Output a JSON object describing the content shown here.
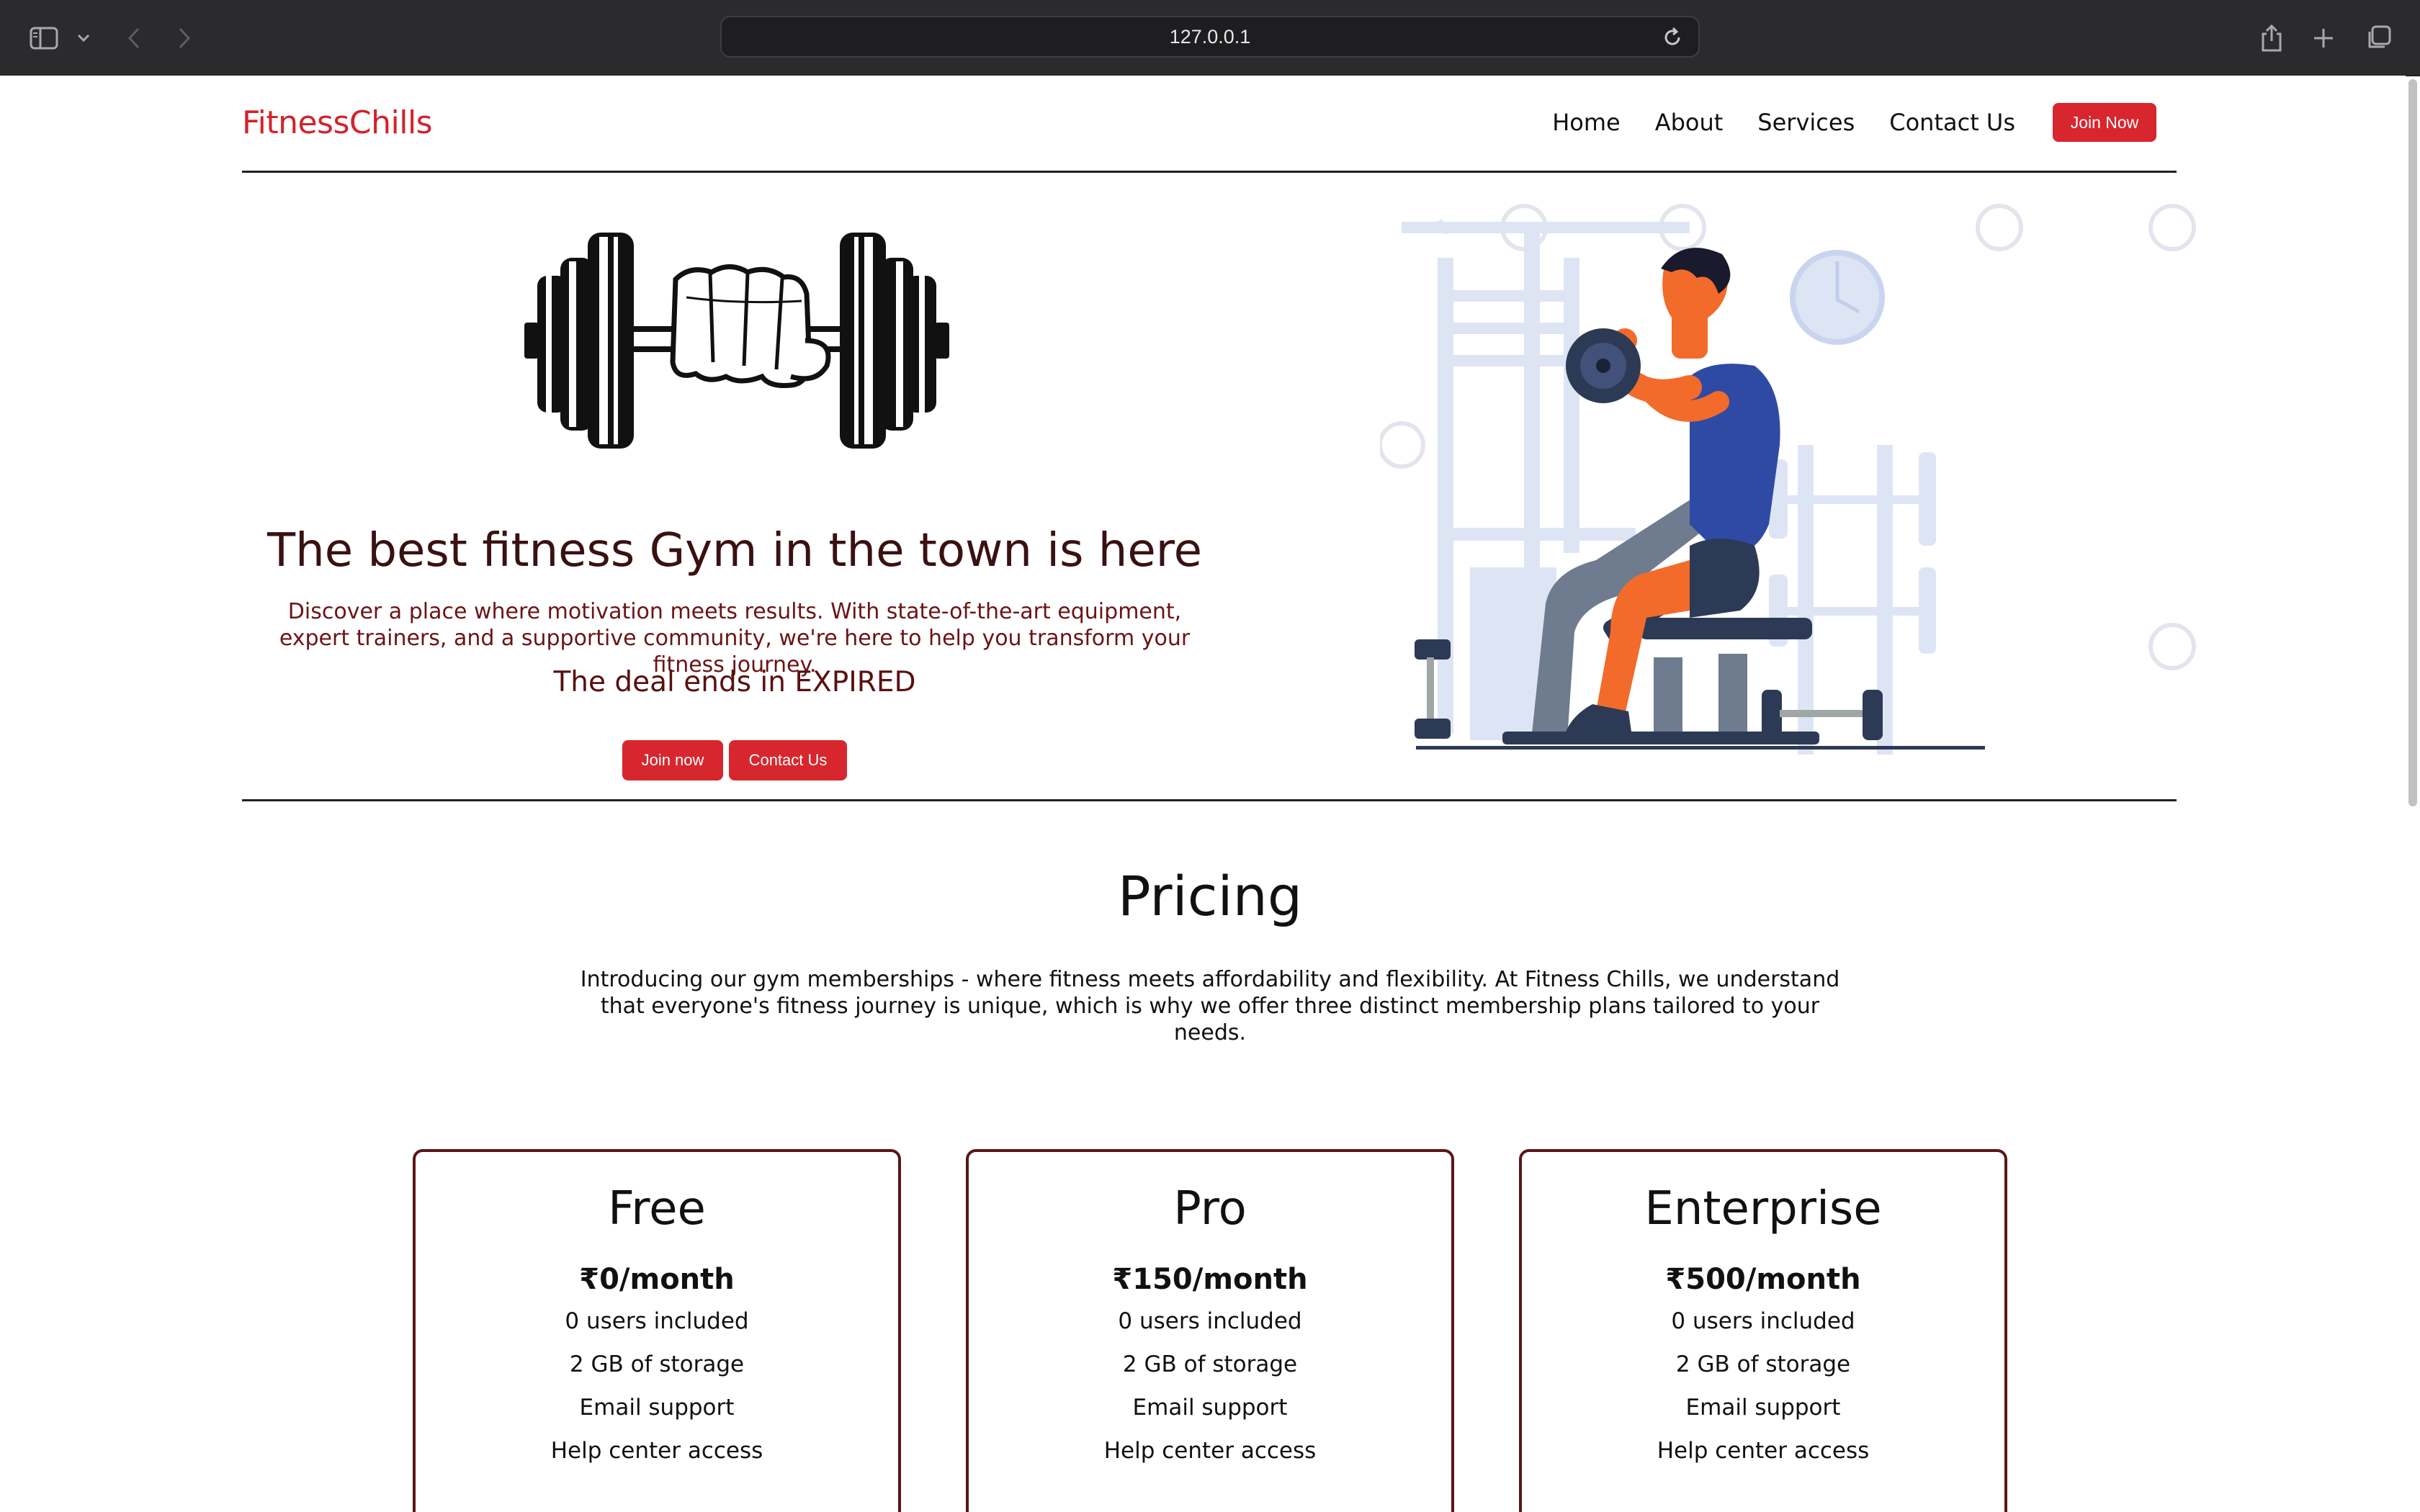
{
  "browser": {
    "url": "127.0.0.1"
  },
  "nav": {
    "brand": "FitnessChills",
    "links": [
      "Home",
      "About",
      "Services",
      "Contact Us"
    ],
    "cta": "Join Now"
  },
  "hero": {
    "title": "The best fitness Gym in the town is here",
    "lead": "Discover a place where motivation meets results. With state-of-the-art equipment, expert trainers, and a supportive community, we're here to help you transform your fitness journey.",
    "deal": "The deal ends in EXPIRED",
    "buttons": [
      "Join now",
      "Contact Us"
    ]
  },
  "pricing": {
    "title": "Pricing",
    "lead": "Introducing our gym memberships - where fitness meets affordability and flexibility. At Fitness Chills, we understand that everyone's fitness journey is unique, which is why we offer three distinct membership plans tailored to your needs.",
    "plans": [
      {
        "name": "Free",
        "price": "₹0/month",
        "features": [
          "0 users included",
          "2 GB of storage",
          "Email support",
          "Help center access"
        ]
      },
      {
        "name": "Pro",
        "price": "₹150/month",
        "features": [
          "0 users included",
          "2 GB of storage",
          "Email support",
          "Help center access"
        ]
      },
      {
        "name": "Enterprise",
        "price": "₹500/month",
        "features": [
          "0 users included",
          "2 GB of storage",
          "Email support",
          "Help center access"
        ]
      }
    ]
  },
  "colors": {
    "brand": "#d2232a",
    "button": "#d7262d",
    "title": "#3a1111",
    "card_border": "#5a1616"
  }
}
